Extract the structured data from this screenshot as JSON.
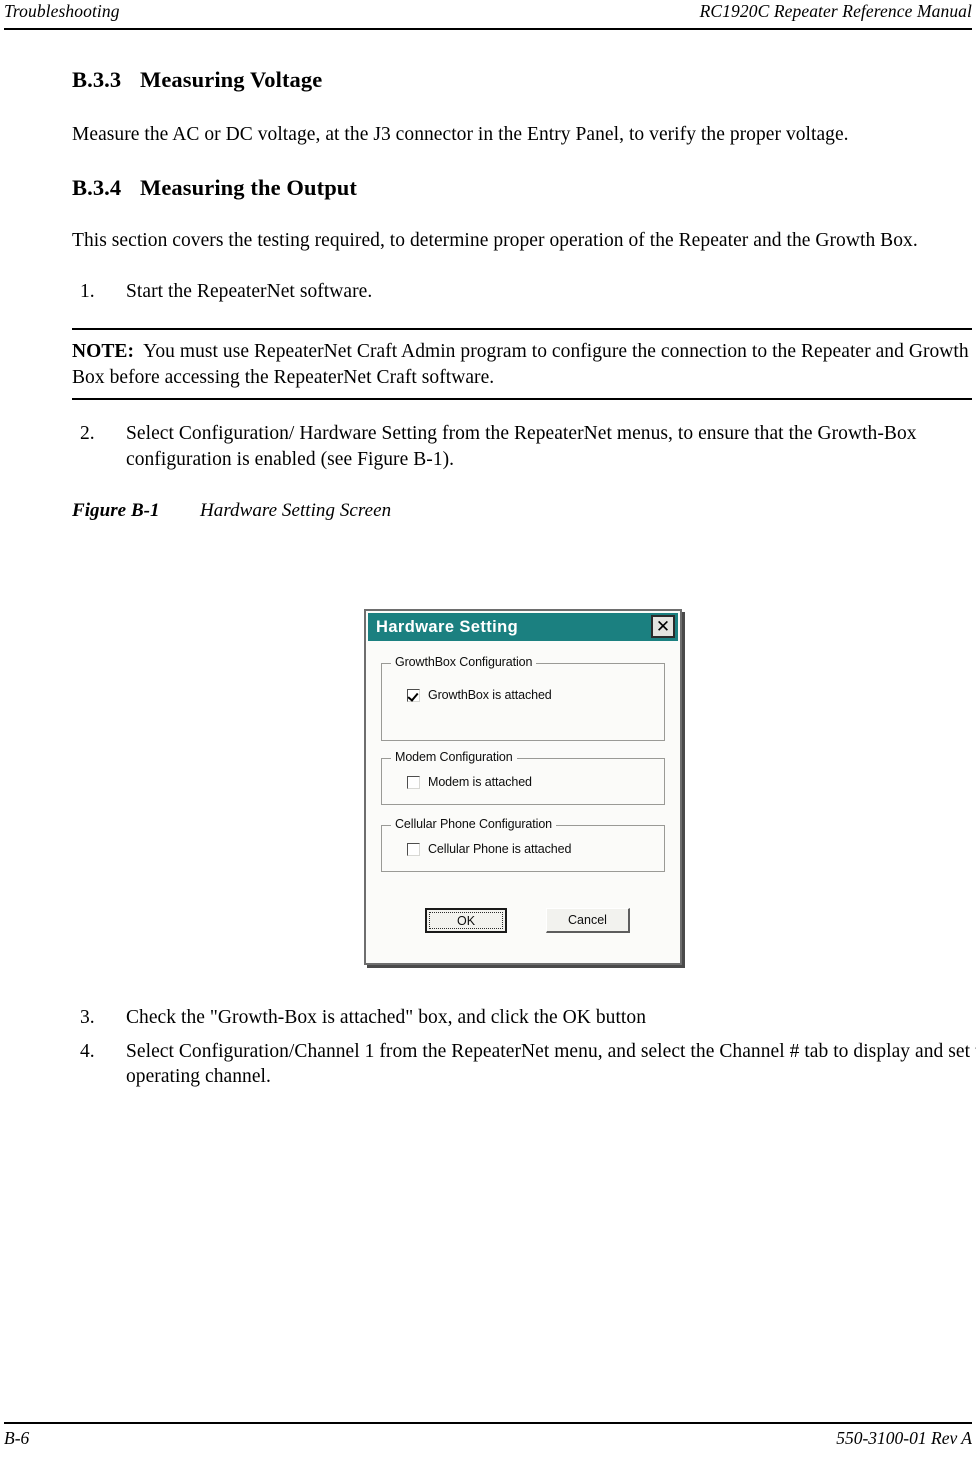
{
  "header": {
    "left": "Troubleshooting",
    "right": "RC1920C Repeater Reference Manual"
  },
  "footer": {
    "left": "B-6",
    "right": "550-3100-01 Rev A"
  },
  "sections": {
    "b33": {
      "number": "B.3.3",
      "title": "Measuring Voltage",
      "paragraph": "Measure the AC or DC voltage, at the J3 connector in the Entry Panel, to verify the proper voltage."
    },
    "b34": {
      "number": "B.3.4",
      "title": "Measuring the Output",
      "paragraph": "This section covers the testing required, to determine proper operation of the Repeater and the Growth Box."
    }
  },
  "steps": {
    "step1": {
      "num": "1.",
      "text": "Start the RepeaterNet software."
    },
    "step2": {
      "num": "2.",
      "text": "Select Configuration/ Hardware Setting from the RepeaterNet menus, to ensure that the Growth-Box configuration is enabled (see Figure B-1)."
    },
    "step3": {
      "num": "3.",
      "text": "Check the \"Growth-Box is attached\" box, and click the OK button"
    },
    "step4": {
      "num": "4.",
      "text": "Select Configuration/Channel 1 from the RepeaterNet menu, and select the Channel # tab to display and set the operating channel."
    }
  },
  "note": {
    "label": "NOTE:",
    "text": "You must use RepeaterNet Craft Admin program to configure the connection to the Repeater and Growth Box before accessing the RepeaterNet Craft software."
  },
  "figure": {
    "number": "Figure B-1",
    "caption": "Hardware Setting Screen"
  },
  "dialog": {
    "title": "Hardware Setting",
    "close_icon": "close-x-icon",
    "titlebar_color": "#1b8080",
    "groups": {
      "growthbox": {
        "legend": "GrowthBox Configuration",
        "checkbox_label": "GrowthBox is attached",
        "checked": "checked"
      },
      "modem": {
        "legend": "Modem Configuration",
        "checkbox_label": "Modem is attached",
        "checked": "unchecked"
      },
      "cellular": {
        "legend": "Cellular Phone Configuration",
        "checkbox_label": "Cellular Phone is attached",
        "checked": "unchecked"
      }
    },
    "buttons": {
      "ok": "OK",
      "cancel": "Cancel"
    }
  }
}
